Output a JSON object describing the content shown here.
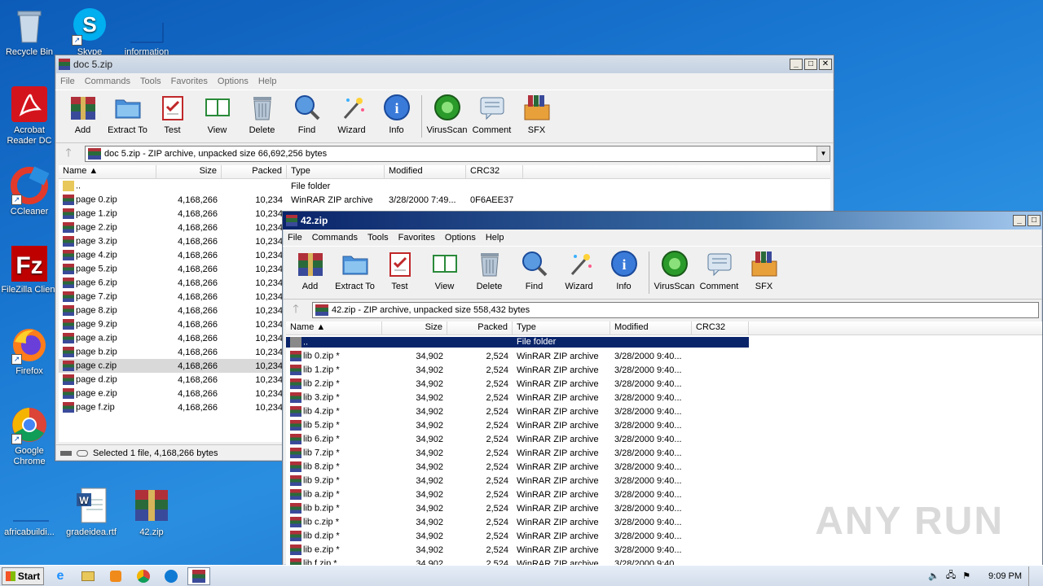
{
  "desktop": {
    "icons": [
      {
        "label": "Recycle Bin"
      },
      {
        "label": "Skype"
      },
      {
        "label": "information"
      },
      {
        "label": "Acrobat Reader DC"
      },
      {
        "label": "CCleaner"
      },
      {
        "label": "FileZilla Client"
      },
      {
        "label": "Firefox"
      },
      {
        "label": "Google Chrome"
      },
      {
        "label": "africabuildi..."
      },
      {
        "label": "gradeidea.rtf"
      },
      {
        "label": "42.zip"
      }
    ]
  },
  "win1": {
    "title": "doc 5.zip",
    "menu": [
      "File",
      "Commands",
      "Tools",
      "Favorites",
      "Options",
      "Help"
    ],
    "toolbar": [
      "Add",
      "Extract To",
      "Test",
      "View",
      "Delete",
      "Find",
      "Wizard",
      "Info",
      "VirusScan",
      "Comment",
      "SFX"
    ],
    "address": "doc 5.zip - ZIP archive, unpacked size 66,692,256 bytes",
    "columns": [
      "Name",
      "Size",
      "Packed",
      "Type",
      "Modified",
      "CRC32"
    ],
    "parent": {
      "name": "..",
      "type": "File folder"
    },
    "rows": [
      {
        "name": "page 0.zip",
        "size": "4,168,266",
        "packed": "10,234",
        "type": "WinRAR ZIP archive",
        "modified": "3/28/2000 7:49...",
        "crc": "0F6AEE37"
      },
      {
        "name": "page 1.zip",
        "size": "4,168,266",
        "packed": "10,234"
      },
      {
        "name": "page 2.zip",
        "size": "4,168,266",
        "packed": "10,234"
      },
      {
        "name": "page 3.zip",
        "size": "4,168,266",
        "packed": "10,234"
      },
      {
        "name": "page 4.zip",
        "size": "4,168,266",
        "packed": "10,234"
      },
      {
        "name": "page 5.zip",
        "size": "4,168,266",
        "packed": "10,234"
      },
      {
        "name": "page 6.zip",
        "size": "4,168,266",
        "packed": "10,234"
      },
      {
        "name": "page 7.zip",
        "size": "4,168,266",
        "packed": "10,234"
      },
      {
        "name": "page 8.zip",
        "size": "4,168,266",
        "packed": "10,234"
      },
      {
        "name": "page 9.zip",
        "size": "4,168,266",
        "packed": "10,234"
      },
      {
        "name": "page a.zip",
        "size": "4,168,266",
        "packed": "10,234"
      },
      {
        "name": "page b.zip",
        "size": "4,168,266",
        "packed": "10,234"
      },
      {
        "name": "page c.zip",
        "size": "4,168,266",
        "packed": "10,234"
      },
      {
        "name": "page d.zip",
        "size": "4,168,266",
        "packed": "10,234"
      },
      {
        "name": "page e.zip",
        "size": "4,168,266",
        "packed": "10,234"
      },
      {
        "name": "page f.zip",
        "size": "4,168,266",
        "packed": "10,234"
      }
    ],
    "status": "Selected 1 file, 4,168,266 bytes"
  },
  "win2": {
    "title": "42.zip",
    "menu": [
      "File",
      "Commands",
      "Tools",
      "Favorites",
      "Options",
      "Help"
    ],
    "toolbar": [
      "Add",
      "Extract To",
      "Test",
      "View",
      "Delete",
      "Find",
      "Wizard",
      "Info",
      "VirusScan",
      "Comment",
      "SFX"
    ],
    "address": "42.zip - ZIP archive, unpacked size 558,432 bytes",
    "columns": [
      "Name",
      "Size",
      "Packed",
      "Type",
      "Modified",
      "CRC32"
    ],
    "parent": {
      "name": "..",
      "type": "File folder"
    },
    "rows": [
      {
        "name": "lib 0.zip *",
        "size": "34,902",
        "packed": "2,524",
        "type": "WinRAR ZIP archive",
        "modified": "3/28/2000 9:40..."
      },
      {
        "name": "lib 1.zip *",
        "size": "34,902",
        "packed": "2,524",
        "type": "WinRAR ZIP archive",
        "modified": "3/28/2000 9:40..."
      },
      {
        "name": "lib 2.zip *",
        "size": "34,902",
        "packed": "2,524",
        "type": "WinRAR ZIP archive",
        "modified": "3/28/2000 9:40..."
      },
      {
        "name": "lib 3.zip *",
        "size": "34,902",
        "packed": "2,524",
        "type": "WinRAR ZIP archive",
        "modified": "3/28/2000 9:40..."
      },
      {
        "name": "lib 4.zip *",
        "size": "34,902",
        "packed": "2,524",
        "type": "WinRAR ZIP archive",
        "modified": "3/28/2000 9:40..."
      },
      {
        "name": "lib 5.zip *",
        "size": "34,902",
        "packed": "2,524",
        "type": "WinRAR ZIP archive",
        "modified": "3/28/2000 9:40..."
      },
      {
        "name": "lib 6.zip *",
        "size": "34,902",
        "packed": "2,524",
        "type": "WinRAR ZIP archive",
        "modified": "3/28/2000 9:40..."
      },
      {
        "name": "lib 7.zip *",
        "size": "34,902",
        "packed": "2,524",
        "type": "WinRAR ZIP archive",
        "modified": "3/28/2000 9:40..."
      },
      {
        "name": "lib 8.zip *",
        "size": "34,902",
        "packed": "2,524",
        "type": "WinRAR ZIP archive",
        "modified": "3/28/2000 9:40..."
      },
      {
        "name": "lib 9.zip *",
        "size": "34,902",
        "packed": "2,524",
        "type": "WinRAR ZIP archive",
        "modified": "3/28/2000 9:40..."
      },
      {
        "name": "lib a.zip *",
        "size": "34,902",
        "packed": "2,524",
        "type": "WinRAR ZIP archive",
        "modified": "3/28/2000 9:40..."
      },
      {
        "name": "lib b.zip *",
        "size": "34,902",
        "packed": "2,524",
        "type": "WinRAR ZIP archive",
        "modified": "3/28/2000 9:40..."
      },
      {
        "name": "lib c.zip *",
        "size": "34,902",
        "packed": "2,524",
        "type": "WinRAR ZIP archive",
        "modified": "3/28/2000 9:40..."
      },
      {
        "name": "lib d.zip *",
        "size": "34,902",
        "packed": "2,524",
        "type": "WinRAR ZIP archive",
        "modified": "3/28/2000 9:40..."
      },
      {
        "name": "lib e.zip *",
        "size": "34,902",
        "packed": "2,524",
        "type": "WinRAR ZIP archive",
        "modified": "3/28/2000 9:40..."
      },
      {
        "name": "lib f.zip *",
        "size": "34,902",
        "packed": "2,524",
        "type": "WinRAR ZIP archive",
        "modified": "3/28/2000 9:40..."
      }
    ]
  },
  "taskbar": {
    "start_label": "Start",
    "clock": "9:09 PM"
  },
  "watermark": "ANY RUN"
}
